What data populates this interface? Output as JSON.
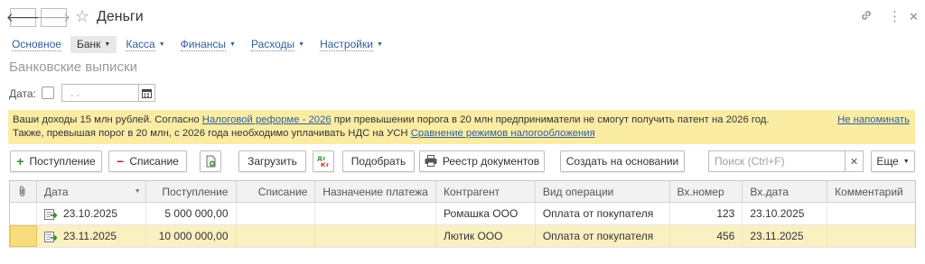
{
  "window": {
    "title": "Деньги",
    "back_icon": "arrow-left-icon",
    "forward_icon": "arrow-right-icon",
    "favorite_icon": "star-icon",
    "link_icon": "link-icon",
    "more_icon": "vertical-dots-icon",
    "close_icon": "close-icon"
  },
  "menu": {
    "items": [
      {
        "label": "Основное"
      },
      {
        "label": "Банк"
      },
      {
        "label": "Касса"
      },
      {
        "label": "Финансы"
      },
      {
        "label": "Расходы"
      },
      {
        "label": "Настройки"
      }
    ]
  },
  "section_title": "Банковские выписки",
  "filter": {
    "date_label": "Дата:",
    "date_value": ". ."
  },
  "banner": {
    "line1_pre": "Ваши доходы 15 млн рублей. Согласно ",
    "line1_link": "Налоговой реформе - 2026",
    "line1_post": " при превышении порога в 20 млн предприниматели не смогут получить патент на 2026 год.",
    "line2_pre": "Также, превышая порог в 20 млн, с 2026 года необходимо уплачивать НДС на УСН ",
    "line2_link": "Сравнение режимов налогообложения",
    "dismiss": "Не напоминать",
    "bg_color": "#fbeca4"
  },
  "toolbar": {
    "receipt_label": "Поступление",
    "writeoff_label": "Списание",
    "load_label": "Загрузить",
    "select_label": "Подобрать",
    "registry_label": "Реестр документов",
    "create_based_label": "Создать на основании",
    "search_placeholder": "Поиск (Ctrl+F)",
    "more_label": "Еще"
  },
  "table": {
    "headers": {
      "date": "Дата",
      "receipt": "Поступление",
      "writeoff": "Списание",
      "purpose": "Назначение платежа",
      "counterparty": "Контрагент",
      "operation": "Вид операции",
      "in_number": "Вх.номер",
      "in_date": "Вх.дата",
      "comment": "Комментарий"
    },
    "rows": [
      {
        "date": "23.10.2025",
        "receipt": "5 000 000,00",
        "writeoff": "",
        "purpose": "",
        "counterparty": "Ромашка ООО",
        "operation": "Оплата от покупателя",
        "in_number": "123",
        "in_date": "23.10.2025",
        "comment": ""
      },
      {
        "date": "23.11.2025",
        "receipt": "10 000 000,00",
        "writeoff": "",
        "purpose": "",
        "counterparty": "Лютик ООО",
        "operation": "Оплата от покупателя",
        "in_number": "456",
        "in_date": "23.11.2025",
        "comment": ""
      }
    ]
  }
}
